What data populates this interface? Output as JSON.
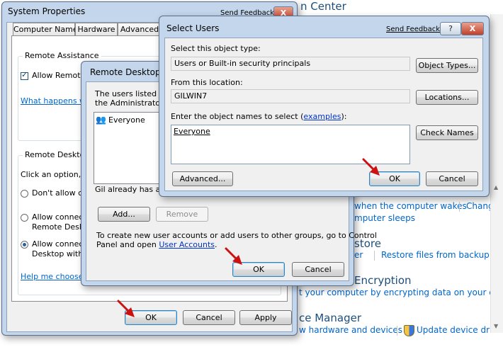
{
  "control_panel": {
    "title_center": "n Center",
    "power_row": {
      "item1": "when the computer wakes",
      "item2": "Chang"
    },
    "power_row2": {
      "item1": "mputer sleeps"
    },
    "backup": {
      "title": "store",
      "item1": "er",
      "item2": "Restore files from backup"
    },
    "bitlocker": {
      "title": "Encryption",
      "item1": "t your computer by encrypting data on your disk"
    },
    "device": {
      "title": "ce Manager",
      "item1": "w hardware and devices",
      "item2": "Update device drive"
    }
  },
  "system_properties": {
    "title": "System Properties",
    "send_feedback": "Send Feedback",
    "close_glyph": "X",
    "tabs": [
      "Computer Name",
      "Hardware",
      "Advanced"
    ],
    "remote_assistance": {
      "group_label": "Remote Assistance",
      "checkbox_label": "Allow Remote",
      "help_link": "What happens w"
    },
    "remote_desktop": {
      "group_label": "Remote Desktop",
      "prompt": "Click an option, a",
      "option1": "Don't allow c",
      "option2_line1": "Allow connec",
      "option2_line2": "Remote Desk",
      "option3_line1": "Allow connec",
      "option3_line2": "Desktop with",
      "help_link": "Help me choose"
    },
    "buttons": {
      "ok": "OK",
      "cancel": "Cancel",
      "apply": "Apply"
    }
  },
  "remote_desktop_users": {
    "title": "Remote Desktop U",
    "info_line1": "The users listed b",
    "info_line2": "the Administrators g",
    "users": [
      {
        "name": "Everyone"
      }
    ],
    "status": "Gil already has acc",
    "buttons": {
      "add": "Add...",
      "remove": "Remove",
      "ok": "OK",
      "cancel": "Cancel"
    },
    "footer_line1": "To create new user accounts or add users to other groups, go to Control",
    "footer_line2_prefix": "Panel and open ",
    "footer_link": "User Accounts",
    "footer_suffix": "."
  },
  "select_users": {
    "title": "Select Users",
    "send_feedback": "Send Feedback",
    "help_glyph": "?",
    "close_glyph": "X",
    "object_type_label": "Select this object type:",
    "object_type_value": "Users or Built-in security principals",
    "object_types_button": "Object Types...",
    "location_label": "From this location:",
    "location_value": "GILWIN7",
    "locations_button": "Locations...",
    "names_label_prefix": "Enter the object names to select (",
    "names_label_link": "examples",
    "names_label_suffix": "):",
    "names_value": "Everyone",
    "check_names_button": "Check Names",
    "advanced_button": "Advanced...",
    "ok_button": "OK",
    "cancel_button": "Cancel"
  },
  "colors": {
    "window_frame": "#c3d6ec",
    "arrow": "#cc1111",
    "link": "#0033cc"
  }
}
